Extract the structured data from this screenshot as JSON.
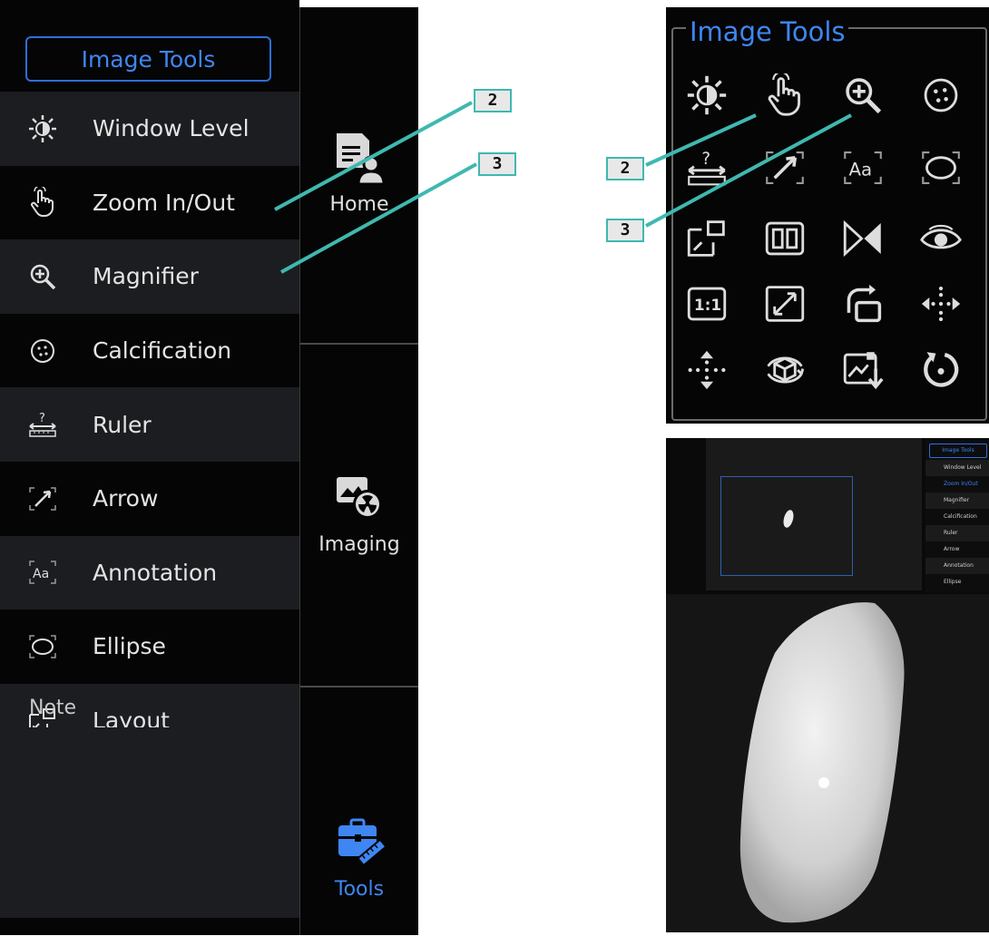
{
  "sidebar": {
    "title": "Image Tools",
    "items": [
      {
        "label": "Window Level",
        "icon": "window-level-icon"
      },
      {
        "label": "Zoom In/Out",
        "icon": "hand-pointer-icon"
      },
      {
        "label": "Magnifier",
        "icon": "magnifier-icon"
      },
      {
        "label": "Calcification",
        "icon": "calcification-icon"
      },
      {
        "label": "Ruler",
        "icon": "ruler-icon"
      },
      {
        "label": "Arrow",
        "icon": "arrow-icon"
      },
      {
        "label": "Annotation",
        "icon": "annotation-icon"
      },
      {
        "label": "Ellipse",
        "icon": "ellipse-icon"
      },
      {
        "label": "Layout",
        "icon": "layout-icon"
      }
    ],
    "note_label": "Note"
  },
  "nav": {
    "home": "Home",
    "imaging": "Imaging",
    "tools": "Tools"
  },
  "grid": {
    "title": "Image Tools",
    "icons": [
      "window-level-icon",
      "hand-pointer-icon",
      "magnifier-icon",
      "calcification-icon",
      "ruler-icon",
      "arrow-icon",
      "annotation-icon",
      "ellipse-icon",
      "layout-icon",
      "compare-icon",
      "flip-icon",
      "eye-icon",
      "one-to-one-icon",
      "fit-icon",
      "rotate-icon",
      "horizontal-move-icon",
      "vertical-move-icon",
      "3d-rotate-icon",
      "save-image-icon",
      "reset-icon"
    ]
  },
  "mini_menu": {
    "title": "Image Tools",
    "items": [
      "Window Level",
      "Zoom In/Out",
      "Magnifier",
      "Calcification",
      "Ruler",
      "Arrow",
      "Annotation",
      "Ellipse"
    ],
    "active": "Zoom In/Out"
  },
  "callouts": {
    "two": "2",
    "three": "3"
  },
  "colors": {
    "accent": "#3f86f2",
    "callout_line": "#3fb8b0",
    "panel_bg": "#050505",
    "row_alt": "#1c1d20"
  }
}
